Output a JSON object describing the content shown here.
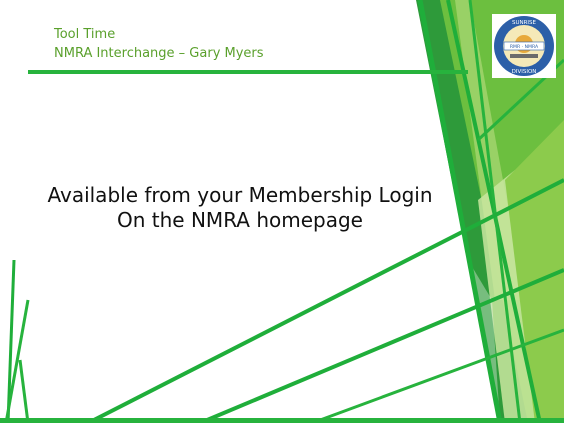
{
  "slide": {
    "header_title": "Tool Time",
    "header_subtitle": "NMRA Interchange – Gary Myers",
    "body_line_1": "Available from your Membership Login",
    "body_line_2": "On the NMRA homepage"
  },
  "logo": {
    "top_text": "SUNRISE",
    "center_text": "RMR · NMRA",
    "bottom_text": "DIVISION"
  },
  "colors": {
    "accent_green": "#27b33d",
    "header_text": "#5aa02c",
    "dark_green": "#1f8a2e",
    "light_green": "#b7dc8a",
    "logo_blue": "#2c5fa8"
  }
}
